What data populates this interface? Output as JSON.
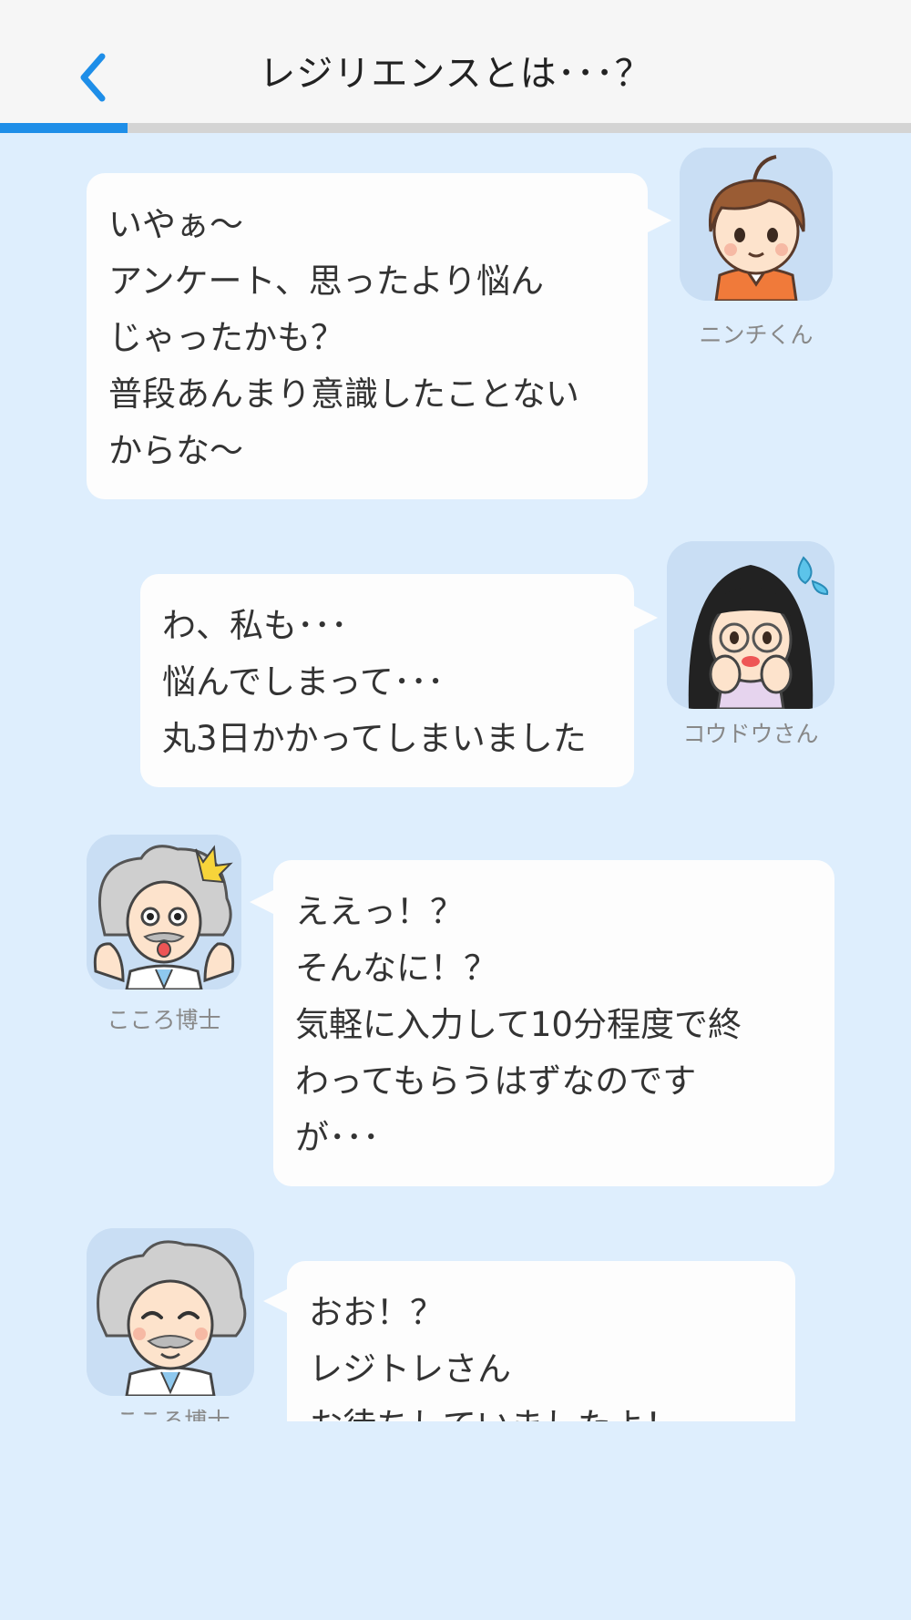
{
  "header": {
    "title": "レジリエンスとは･･･？",
    "back_icon": "chevron-left-icon",
    "accent_color": "#1e8ee8"
  },
  "progress": {
    "fraction": 0.14
  },
  "messages": [
    {
      "speaker": "ニンチくん",
      "side": "right",
      "lines": [
        "いやぁ〜",
        "アンケート、思ったより悩ん",
        "じゃったかも？",
        "普段あんまり意識したことない",
        "からな〜"
      ]
    },
    {
      "speaker": "コウドウさん",
      "side": "right",
      "lines": [
        "わ、私も･･･",
        "悩んでしまって･･･",
        "丸3日かかってしまいました"
      ]
    },
    {
      "speaker": "こころ博士",
      "side": "left",
      "lines": [
        "ええっ！？",
        "そんなに！？",
        "気軽に入力して10分程度で終",
        "わってもらうはずなのです",
        "が･･･"
      ]
    },
    {
      "speaker": "こころ博士",
      "side": "left",
      "lines": [
        "おお！？",
        "レジトレさん",
        "お待ちしていましたよ！"
      ]
    }
  ]
}
